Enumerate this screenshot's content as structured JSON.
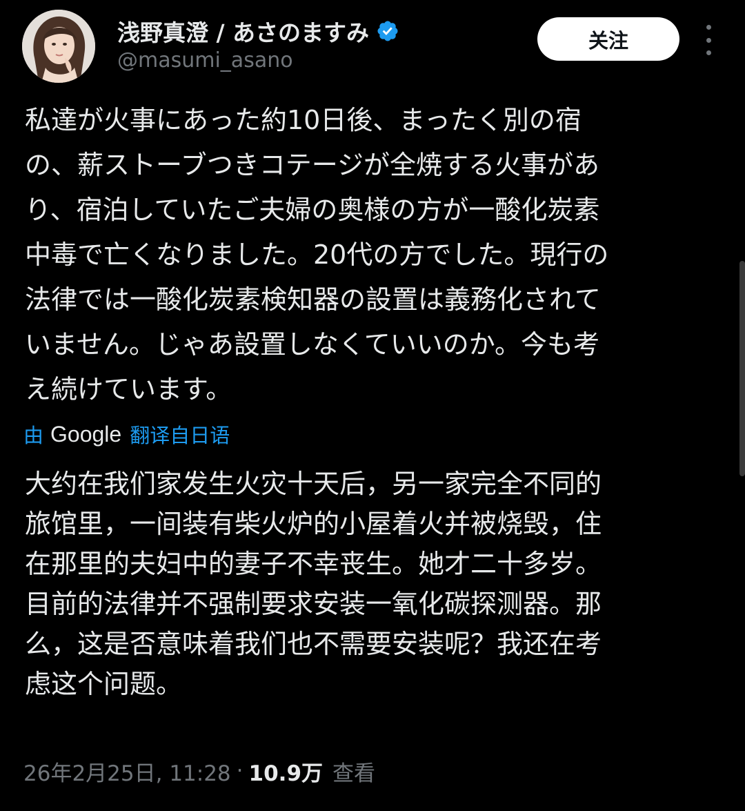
{
  "author": {
    "display_name": "浅野真澄 / あさのますみ",
    "handle": "@masumi_asano",
    "verified_icon": "verified-badge-icon"
  },
  "actions": {
    "follow_label": "关注",
    "more_icon": "more-vertical-icon"
  },
  "tweet": {
    "text_lines": [
      "私達が火事にあった約10日後、まったく別の宿",
      "の、薪ストーブつきコテージが全焼する火事があ",
      "り、宿泊していたご夫婦の奥様の方が一酸化炭素",
      "中毒で亡くなりました。20代の方でした。現行の",
      "法律では一酸化炭素検知器の設置は義務化されて",
      "いません。じゃあ設置しなくていいのか。今も考",
      "え続けています。"
    ]
  },
  "translation": {
    "by_label": "由",
    "provider": "Google",
    "from_label": "翻译自日语",
    "text_lines": [
      "大约在我们家发生火灾十天后，另一家完全不同的",
      "旅馆里，一间装有柴火炉的小屋着火并被烧毁，住",
      "在那里的夫妇中的妻子不幸丧生。她才二十多岁。",
      "目前的法律并不强制要求安装一氧化碳探测器。那",
      "么，这是否意味着我们也不需要安装呢？我还在考",
      "虑这个问题。"
    ]
  },
  "meta": {
    "timestamp": "26年2月25日, 11:28",
    "separator": "·",
    "views_count": "10.9万",
    "views_label": "查看"
  },
  "colors": {
    "background": "#000000",
    "text_primary": "#e7e9ea",
    "text_secondary": "#71767b",
    "accent": "#1d9bf0",
    "follow_button_bg": "#ffffff"
  }
}
